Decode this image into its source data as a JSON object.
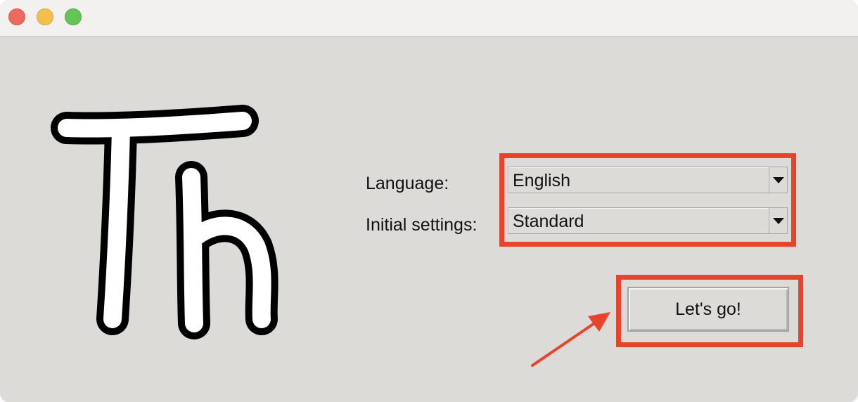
{
  "window": {
    "controls": [
      "close",
      "minimize",
      "maximize"
    ]
  },
  "logo": {
    "text": "Th"
  },
  "form": {
    "language_label": "Language:",
    "language_value": "English",
    "initial_settings_label": "Initial settings:",
    "initial_settings_value": "Standard",
    "submit_label": "Let's go!"
  },
  "annotations": {
    "highlight_color": "#e8432b"
  }
}
